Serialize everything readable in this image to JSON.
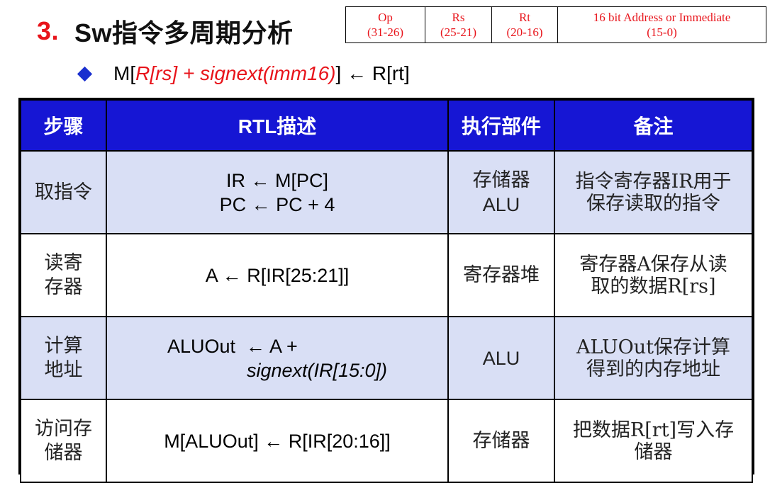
{
  "title": {
    "number": "3.",
    "text": "Sw指令多周期分析"
  },
  "format": [
    {
      "name": "Op",
      "bits": "(31-26)"
    },
    {
      "name": "Rs",
      "bits": "(25-21)"
    },
    {
      "name": "Rt",
      "bits": "(20-16)"
    },
    {
      "name": "16 bit Address or Immediate",
      "bits": "(15-0)"
    }
  ],
  "formula": {
    "prefix": "M[",
    "expr": "R[rs] + signext(imm16)",
    "suffix": "] ← R[rt]"
  },
  "colors": {
    "header_bg": "#1616d4",
    "row_tint": "#d9dff5",
    "accent_red": "#e8141b",
    "bullet_blue": "#1a2fcf"
  },
  "table": {
    "headers": [
      "步骤",
      "RTL描述",
      "执行部件",
      "备注"
    ],
    "rows": [
      {
        "step": [
          "取指令"
        ],
        "rtl": [
          "IR ← M[PC]",
          "PC ← PC + 4"
        ],
        "unit": [
          "存储器",
          "ALU"
        ],
        "note": [
          "指令寄存器IR用于",
          "保存读取的指令"
        ]
      },
      {
        "step": [
          "读寄",
          "存器"
        ],
        "rtl": [
          "A ← R[IR[25:21]]"
        ],
        "unit": [
          "寄存器堆"
        ],
        "note": [
          "寄存器A保存从读",
          "取的数据R[rs]"
        ]
      },
      {
        "step": [
          "计算",
          "地址"
        ],
        "rtl": [
          "ALUOut  ← A +",
          "signext(IR[15:0])"
        ],
        "unit": [
          "ALU"
        ],
        "note": [
          "ALUOut保存计算",
          "得到的内存地址"
        ]
      },
      {
        "step": [
          "访问存",
          "储器"
        ],
        "rtl": [
          "M[ALUOut] ← R[IR[20:16]]"
        ],
        "unit": [
          "存储器"
        ],
        "note": [
          "把数据R[rt]写入存",
          "储器"
        ]
      }
    ]
  }
}
